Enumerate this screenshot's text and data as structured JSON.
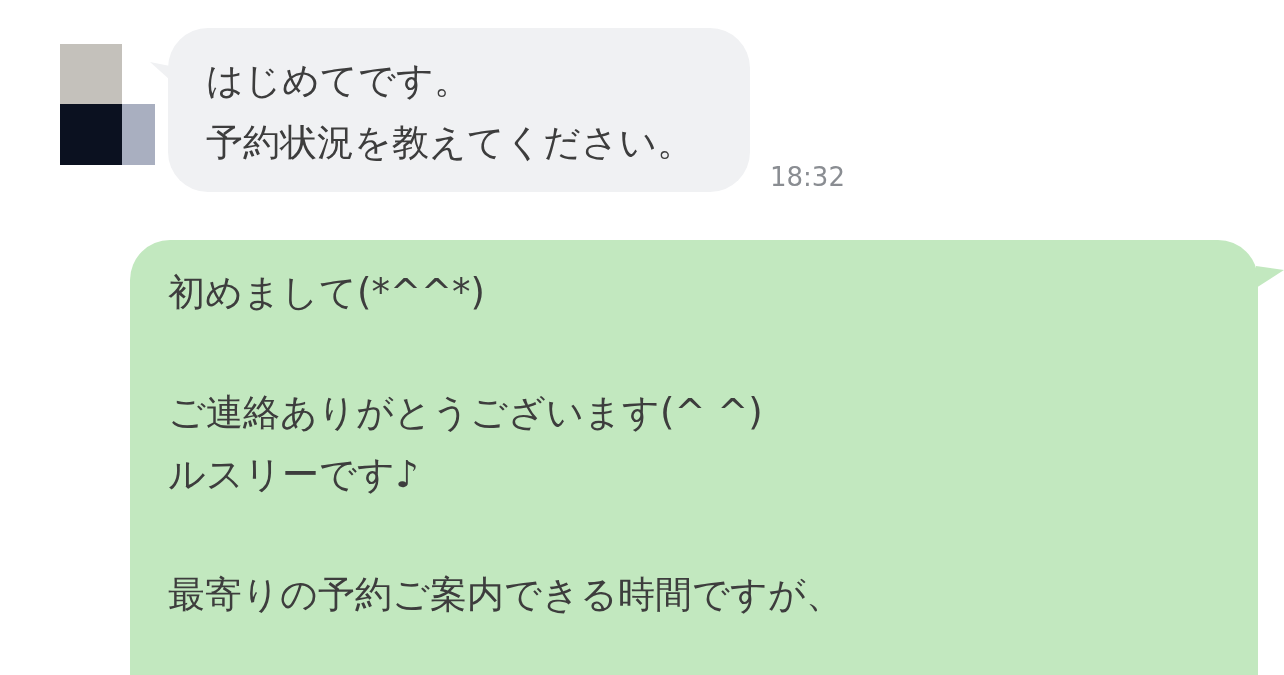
{
  "messages": [
    {
      "kind": "incoming",
      "paragraphs": [
        [
          "はじめてです。",
          "予約状況を教えてください。"
        ]
      ],
      "time": "18:32"
    },
    {
      "kind": "outgoing",
      "paragraphs": [
        [
          "初めまして(*^^*)"
        ],
        [
          "ご連絡ありがとうございます(^ ^)",
          "ルスリーです♪"
        ],
        [
          "最寄りの予約ご案内できる時間ですが、"
        ]
      ]
    }
  ]
}
